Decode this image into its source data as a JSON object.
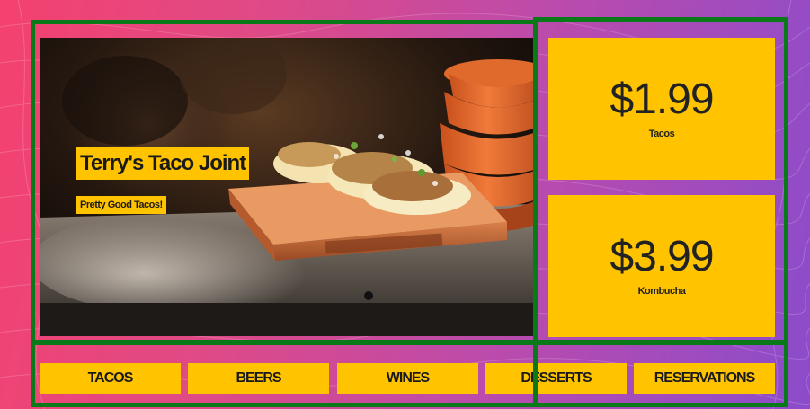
{
  "hero": {
    "title": "Terry's Taco Joint",
    "subtitle": "Pretty Good Tacos!"
  },
  "prices": [
    {
      "price": "$1.99",
      "label": "Tacos"
    },
    {
      "price": "$3.99",
      "label": "Kombucha"
    }
  ],
  "nav": [
    {
      "label": "TACOS"
    },
    {
      "label": "BEERS"
    },
    {
      "label": "WINES"
    },
    {
      "label": "DESSERTS"
    },
    {
      "label": "RESERVATIONS"
    }
  ],
  "colors": {
    "accent": "#ffc300",
    "outline": "#0a7a18",
    "background_start": "#f4416f",
    "background_end": "#8b4ccb"
  }
}
